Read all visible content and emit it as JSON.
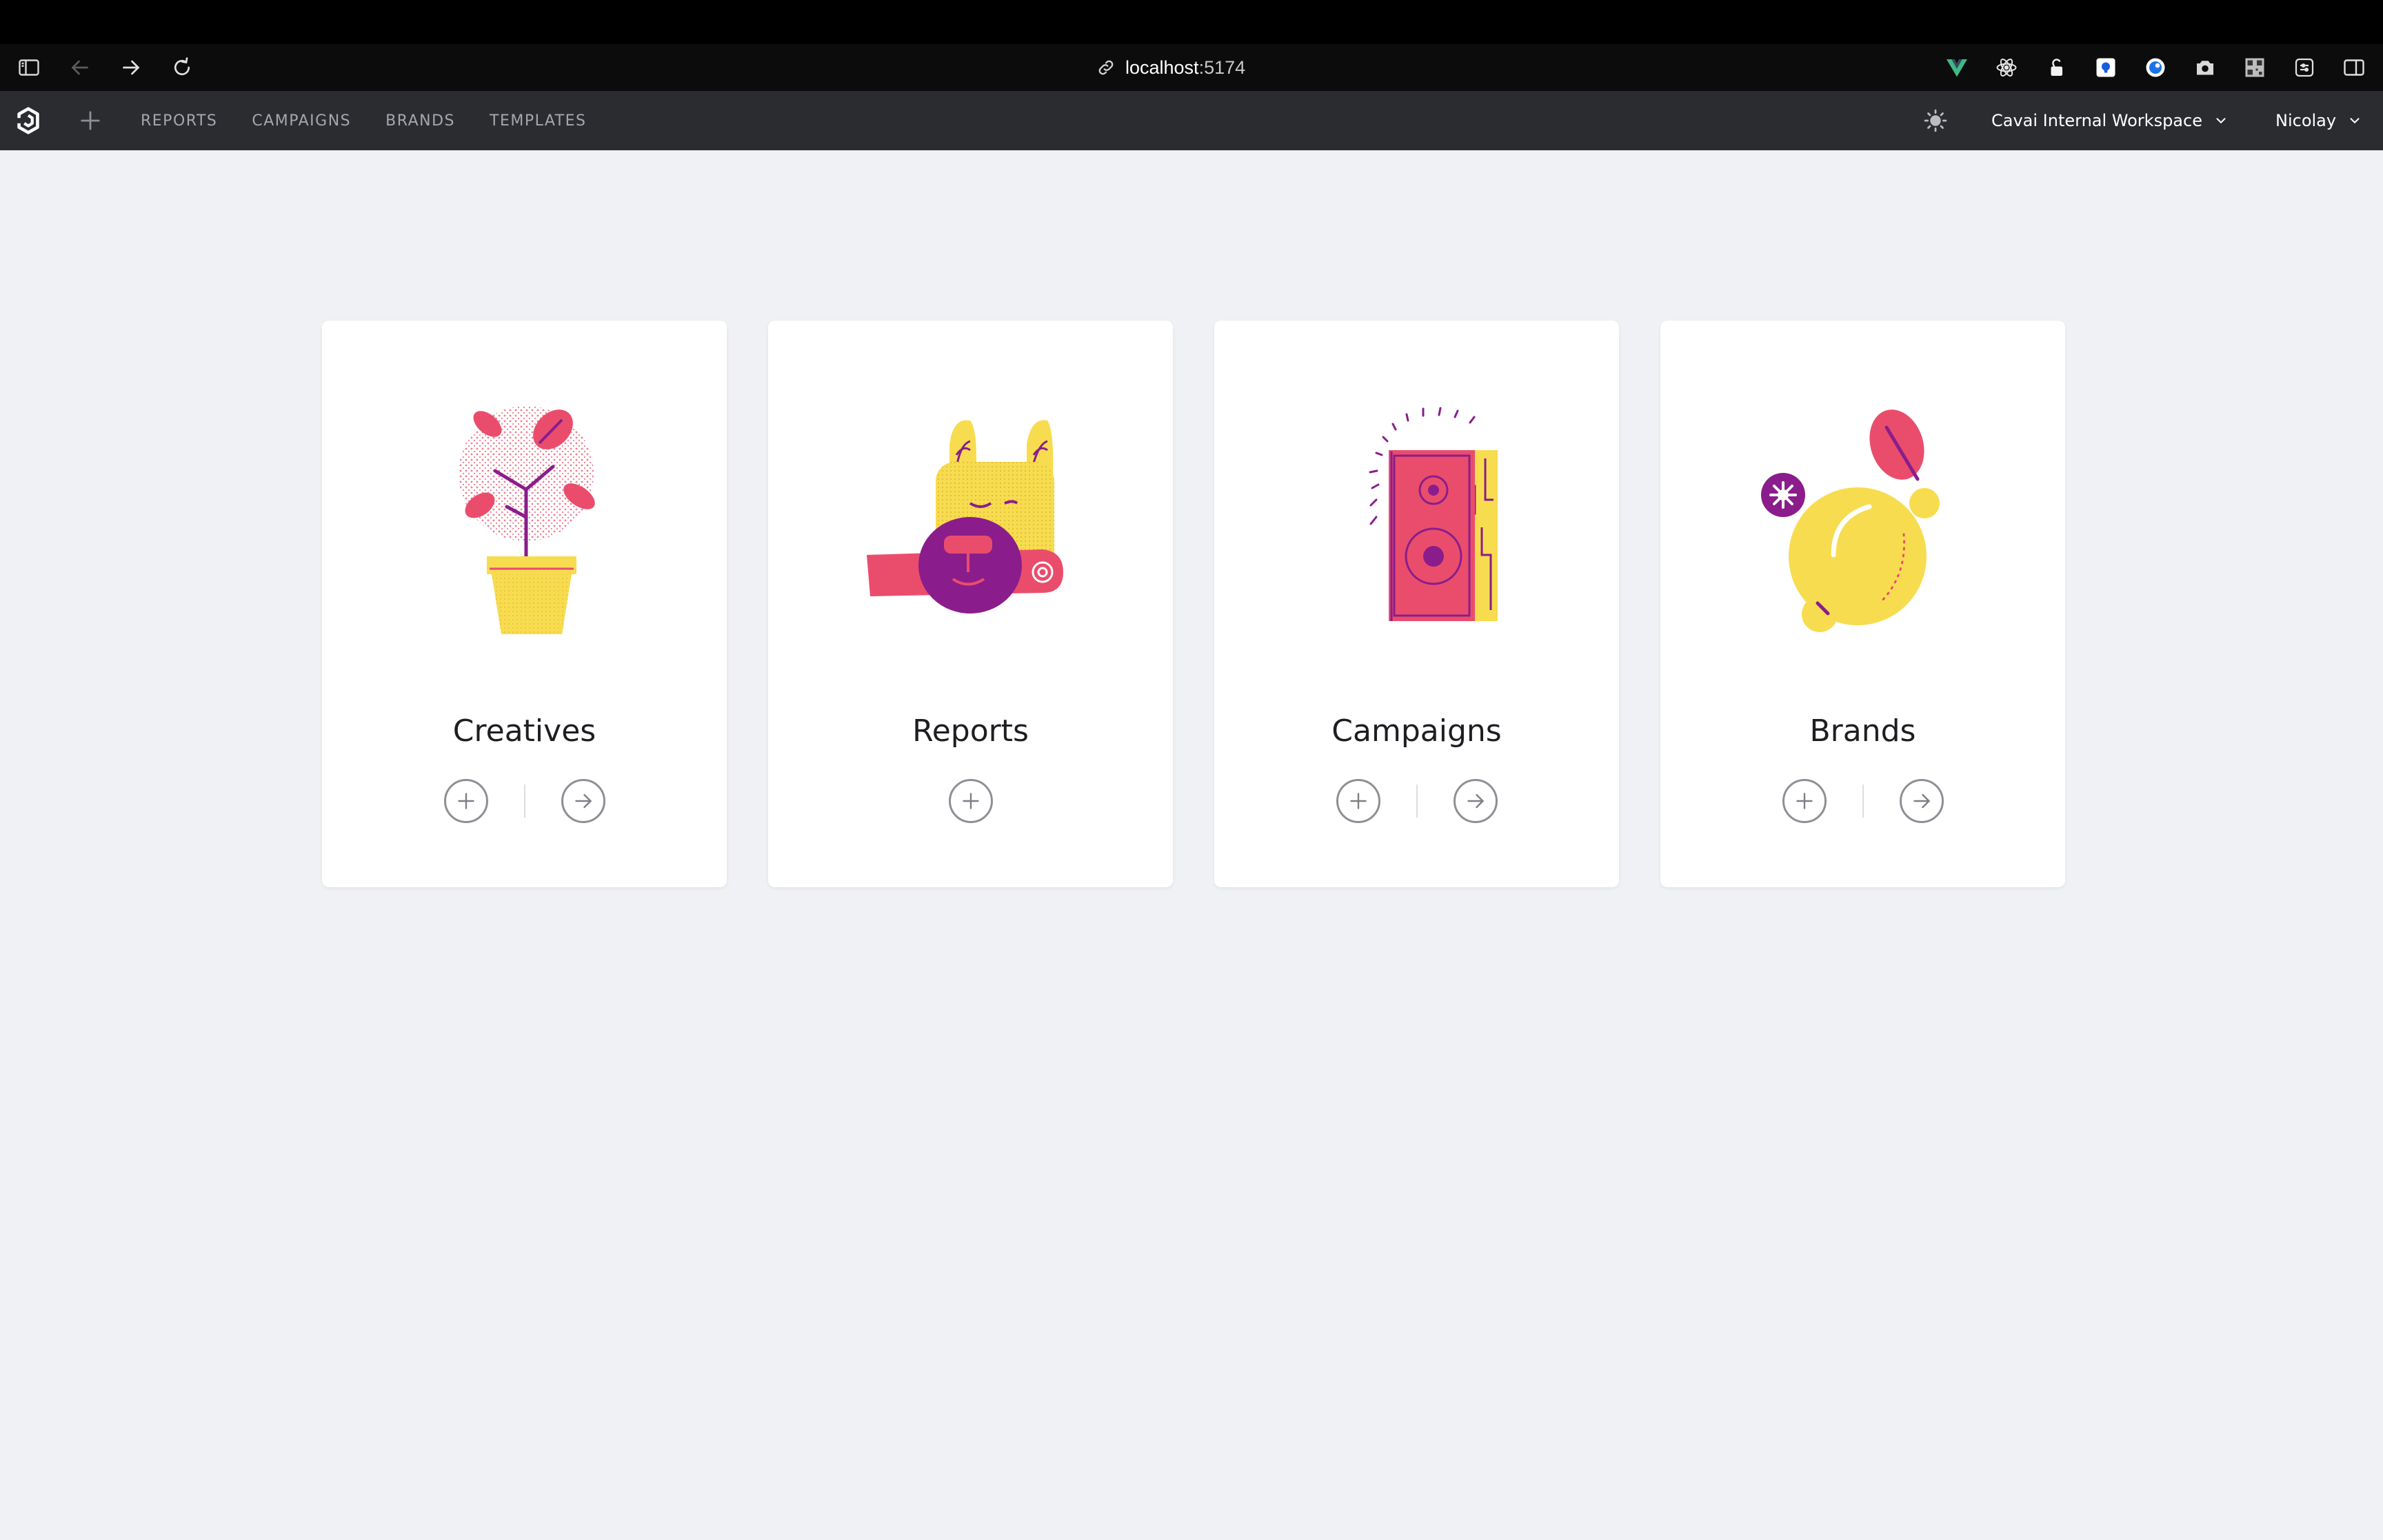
{
  "browser": {
    "url_host": "localhost",
    "url_port": ":5174"
  },
  "nav": {
    "items": [
      "REPORTS",
      "CAMPAIGNS",
      "BRANDS",
      "TEMPLATES"
    ],
    "workspace": "Cavai Internal Workspace",
    "user": "Nicolay"
  },
  "cards": [
    {
      "title": "Creatives",
      "illustration": "plant-pot-icon",
      "actions": [
        "add",
        "open"
      ]
    },
    {
      "title": "Reports",
      "illustration": "dog-scroll-icon",
      "actions": [
        "add"
      ]
    },
    {
      "title": "Campaigns",
      "illustration": "speaker-icon",
      "actions": [
        "add",
        "open"
      ]
    },
    {
      "title": "Brands",
      "illustration": "lemon-icon",
      "actions": [
        "add",
        "open"
      ]
    }
  ],
  "colors": {
    "pink": "#ea4d6c",
    "yellow": "#f8dc4f",
    "purple": "#8a1d8b",
    "app_nav": "#2b2c30",
    "page_bg": "#f0f1f4"
  }
}
